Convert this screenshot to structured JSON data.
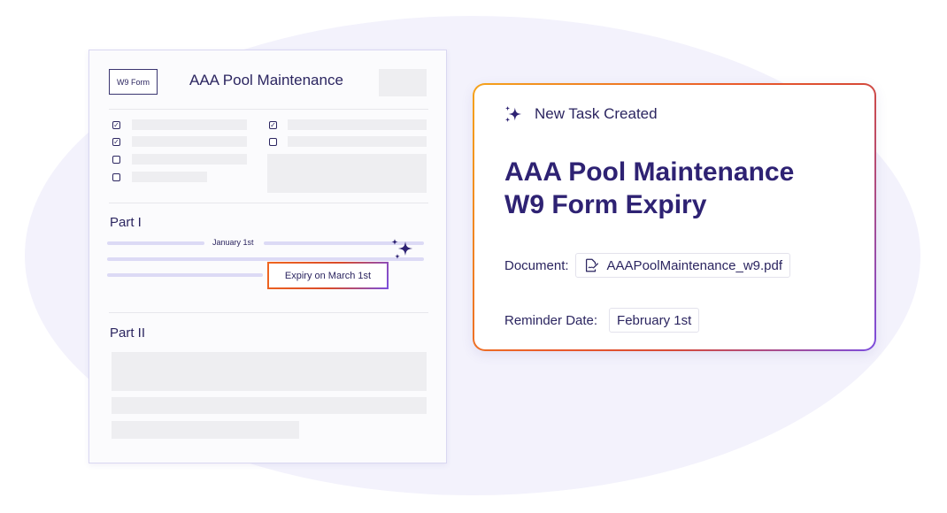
{
  "document": {
    "tag": "W9 Form",
    "title": "AAA Pool Maintenance",
    "part1": "Part I",
    "part2": "Part II",
    "date_label": "January 1st",
    "expiry_label": "Expiry on March 1st",
    "checkboxes": [
      {
        "checked": true
      },
      {
        "checked": true
      },
      {
        "checked": false
      },
      {
        "checked": false
      },
      {
        "checked": true
      },
      {
        "checked": false
      }
    ]
  },
  "task": {
    "header": "New Task Created",
    "title_line1": "AAA Pool Maintenance",
    "title_line2": "W9 Form Expiry",
    "document_label": "Document:",
    "document_value": "AAAPoolMaintenance_w9.pdf",
    "reminder_label": "Reminder Date:",
    "reminder_value": "February 1st"
  },
  "colors": {
    "ink": "#2b2560",
    "title": "#2e2273",
    "accent_orange": "#ea5a2a",
    "accent_purple": "#7b4ddf",
    "background_blob": "#f3f2fc"
  },
  "icons": {
    "header": "sparkles-icon",
    "document": "file-signature-icon",
    "doc_sparkle": "sparkles-icon"
  }
}
